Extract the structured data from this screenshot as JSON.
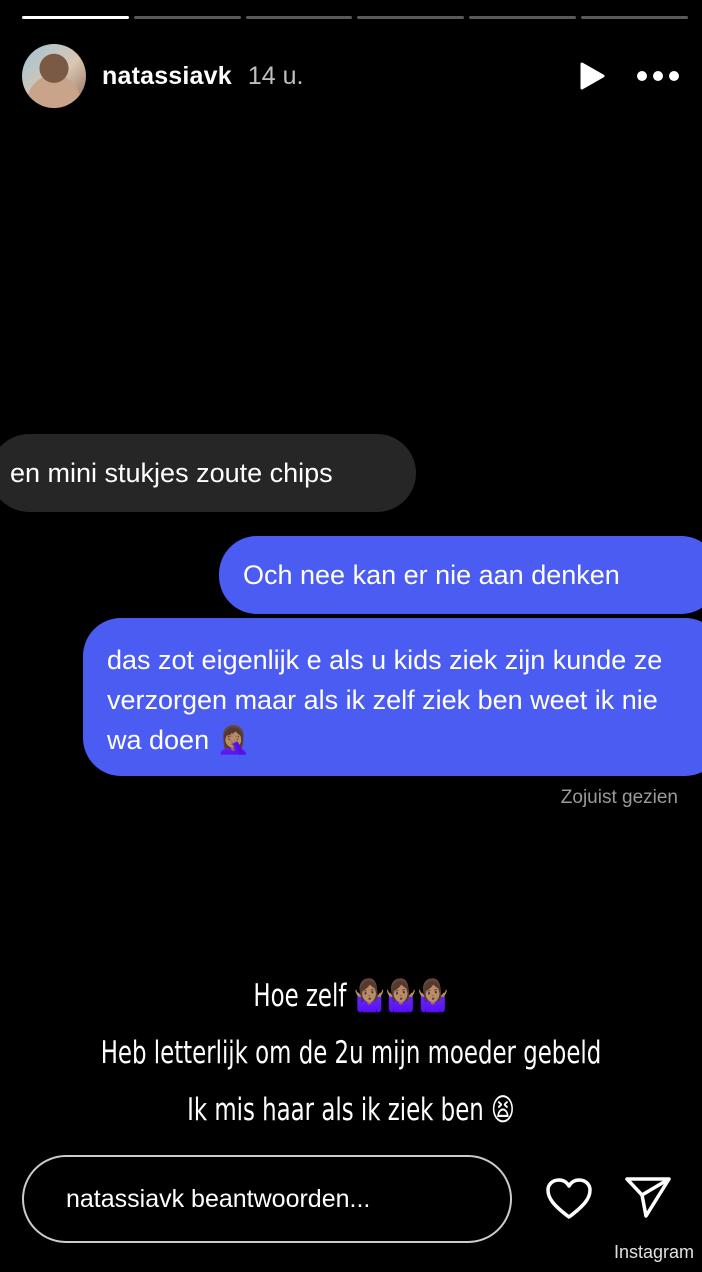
{
  "story": {
    "progress_segments": 6,
    "active_segment": 1,
    "username": "natassiavk",
    "time_ago": "14 u."
  },
  "chat": {
    "incoming": "en mini stukjes zoute chips",
    "outgoing": [
      "Och nee kan er nie aan denken",
      "das zot eigenlijk e als u kids ziek zijn kunde ze verzorgen maar als ik zelf ziek ben weet ik nie wa doen 🤦🏽‍♀️"
    ],
    "seen_status": "Zojuist gezien",
    "incoming_color": "#262626",
    "outgoing_color": "#4b5cf2"
  },
  "caption": {
    "lines": [
      "Hoe zelf 🤷🏽‍♀️🤷🏽‍♀️🤷🏽‍♀️",
      "Heb letterlijk om de 2u mijn moeder gebeld",
      "Ik mis haar als ik ziek ben 😫"
    ]
  },
  "footer": {
    "reply_placeholder": "natassiavk beantwoorden...",
    "watermark": "Instagram"
  },
  "icons": {
    "play": "play-icon",
    "more": "more-dots-icon",
    "like": "heart-icon",
    "share": "send-icon"
  }
}
